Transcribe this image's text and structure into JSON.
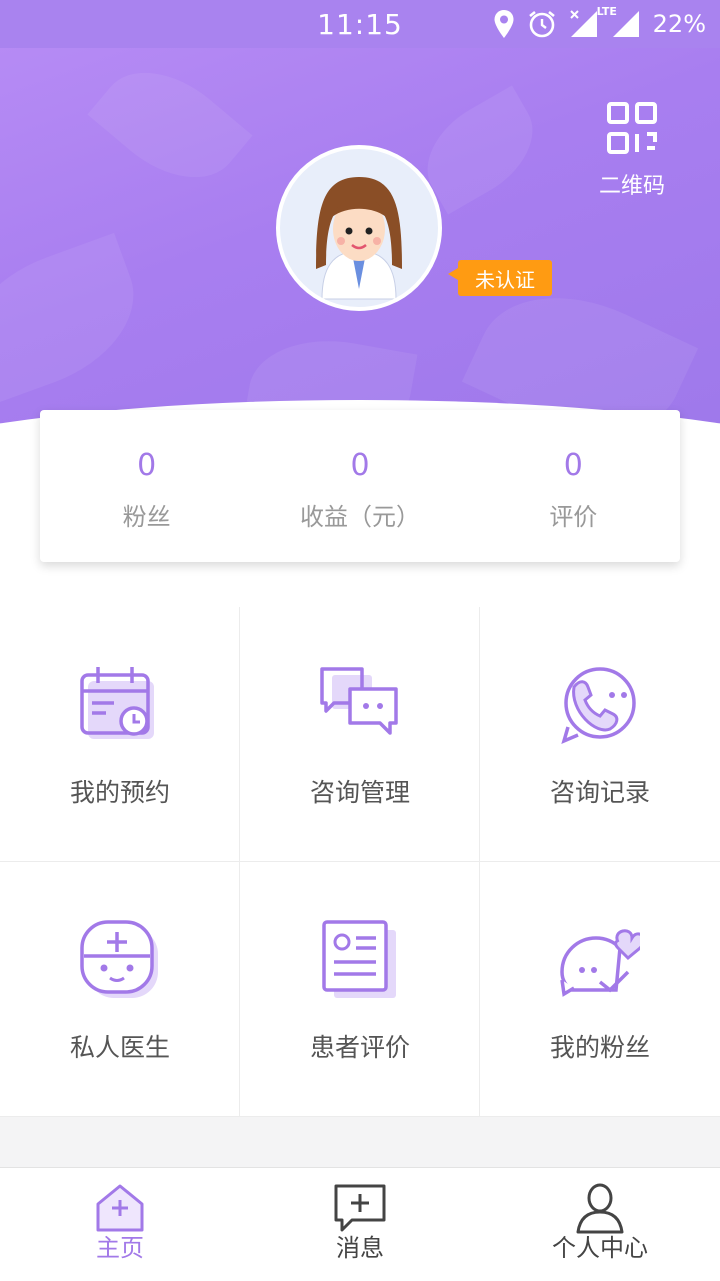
{
  "status_bar": {
    "time": "11:15",
    "network": "LTE",
    "battery": "22%"
  },
  "header": {
    "qr_label": "二维码",
    "badge": "未认证"
  },
  "stats": [
    {
      "value": "0",
      "label": "粉丝"
    },
    {
      "value": "0",
      "label": "收益（元）"
    },
    {
      "value": "0",
      "label": "评价"
    }
  ],
  "menu": [
    {
      "label": "我的预约",
      "icon": "calendar-clock-icon"
    },
    {
      "label": "咨询管理",
      "icon": "chat-bubbles-icon"
    },
    {
      "label": "咨询记录",
      "icon": "phone-bubble-icon"
    },
    {
      "label": "私人医生",
      "icon": "doctor-face-icon"
    },
    {
      "label": "患者评价",
      "icon": "document-card-icon"
    },
    {
      "label": "我的粉丝",
      "icon": "heart-bubble-icon"
    }
  ],
  "tabbar": [
    {
      "label": "主页",
      "icon": "home-plus-icon",
      "active": true
    },
    {
      "label": "消息",
      "icon": "message-plus-icon",
      "active": false
    },
    {
      "label": "个人中心",
      "icon": "person-icon",
      "active": false
    }
  ],
  "colors": {
    "accent": "#a279e8",
    "header": "#a983ef",
    "badge": "#ff9b12"
  }
}
